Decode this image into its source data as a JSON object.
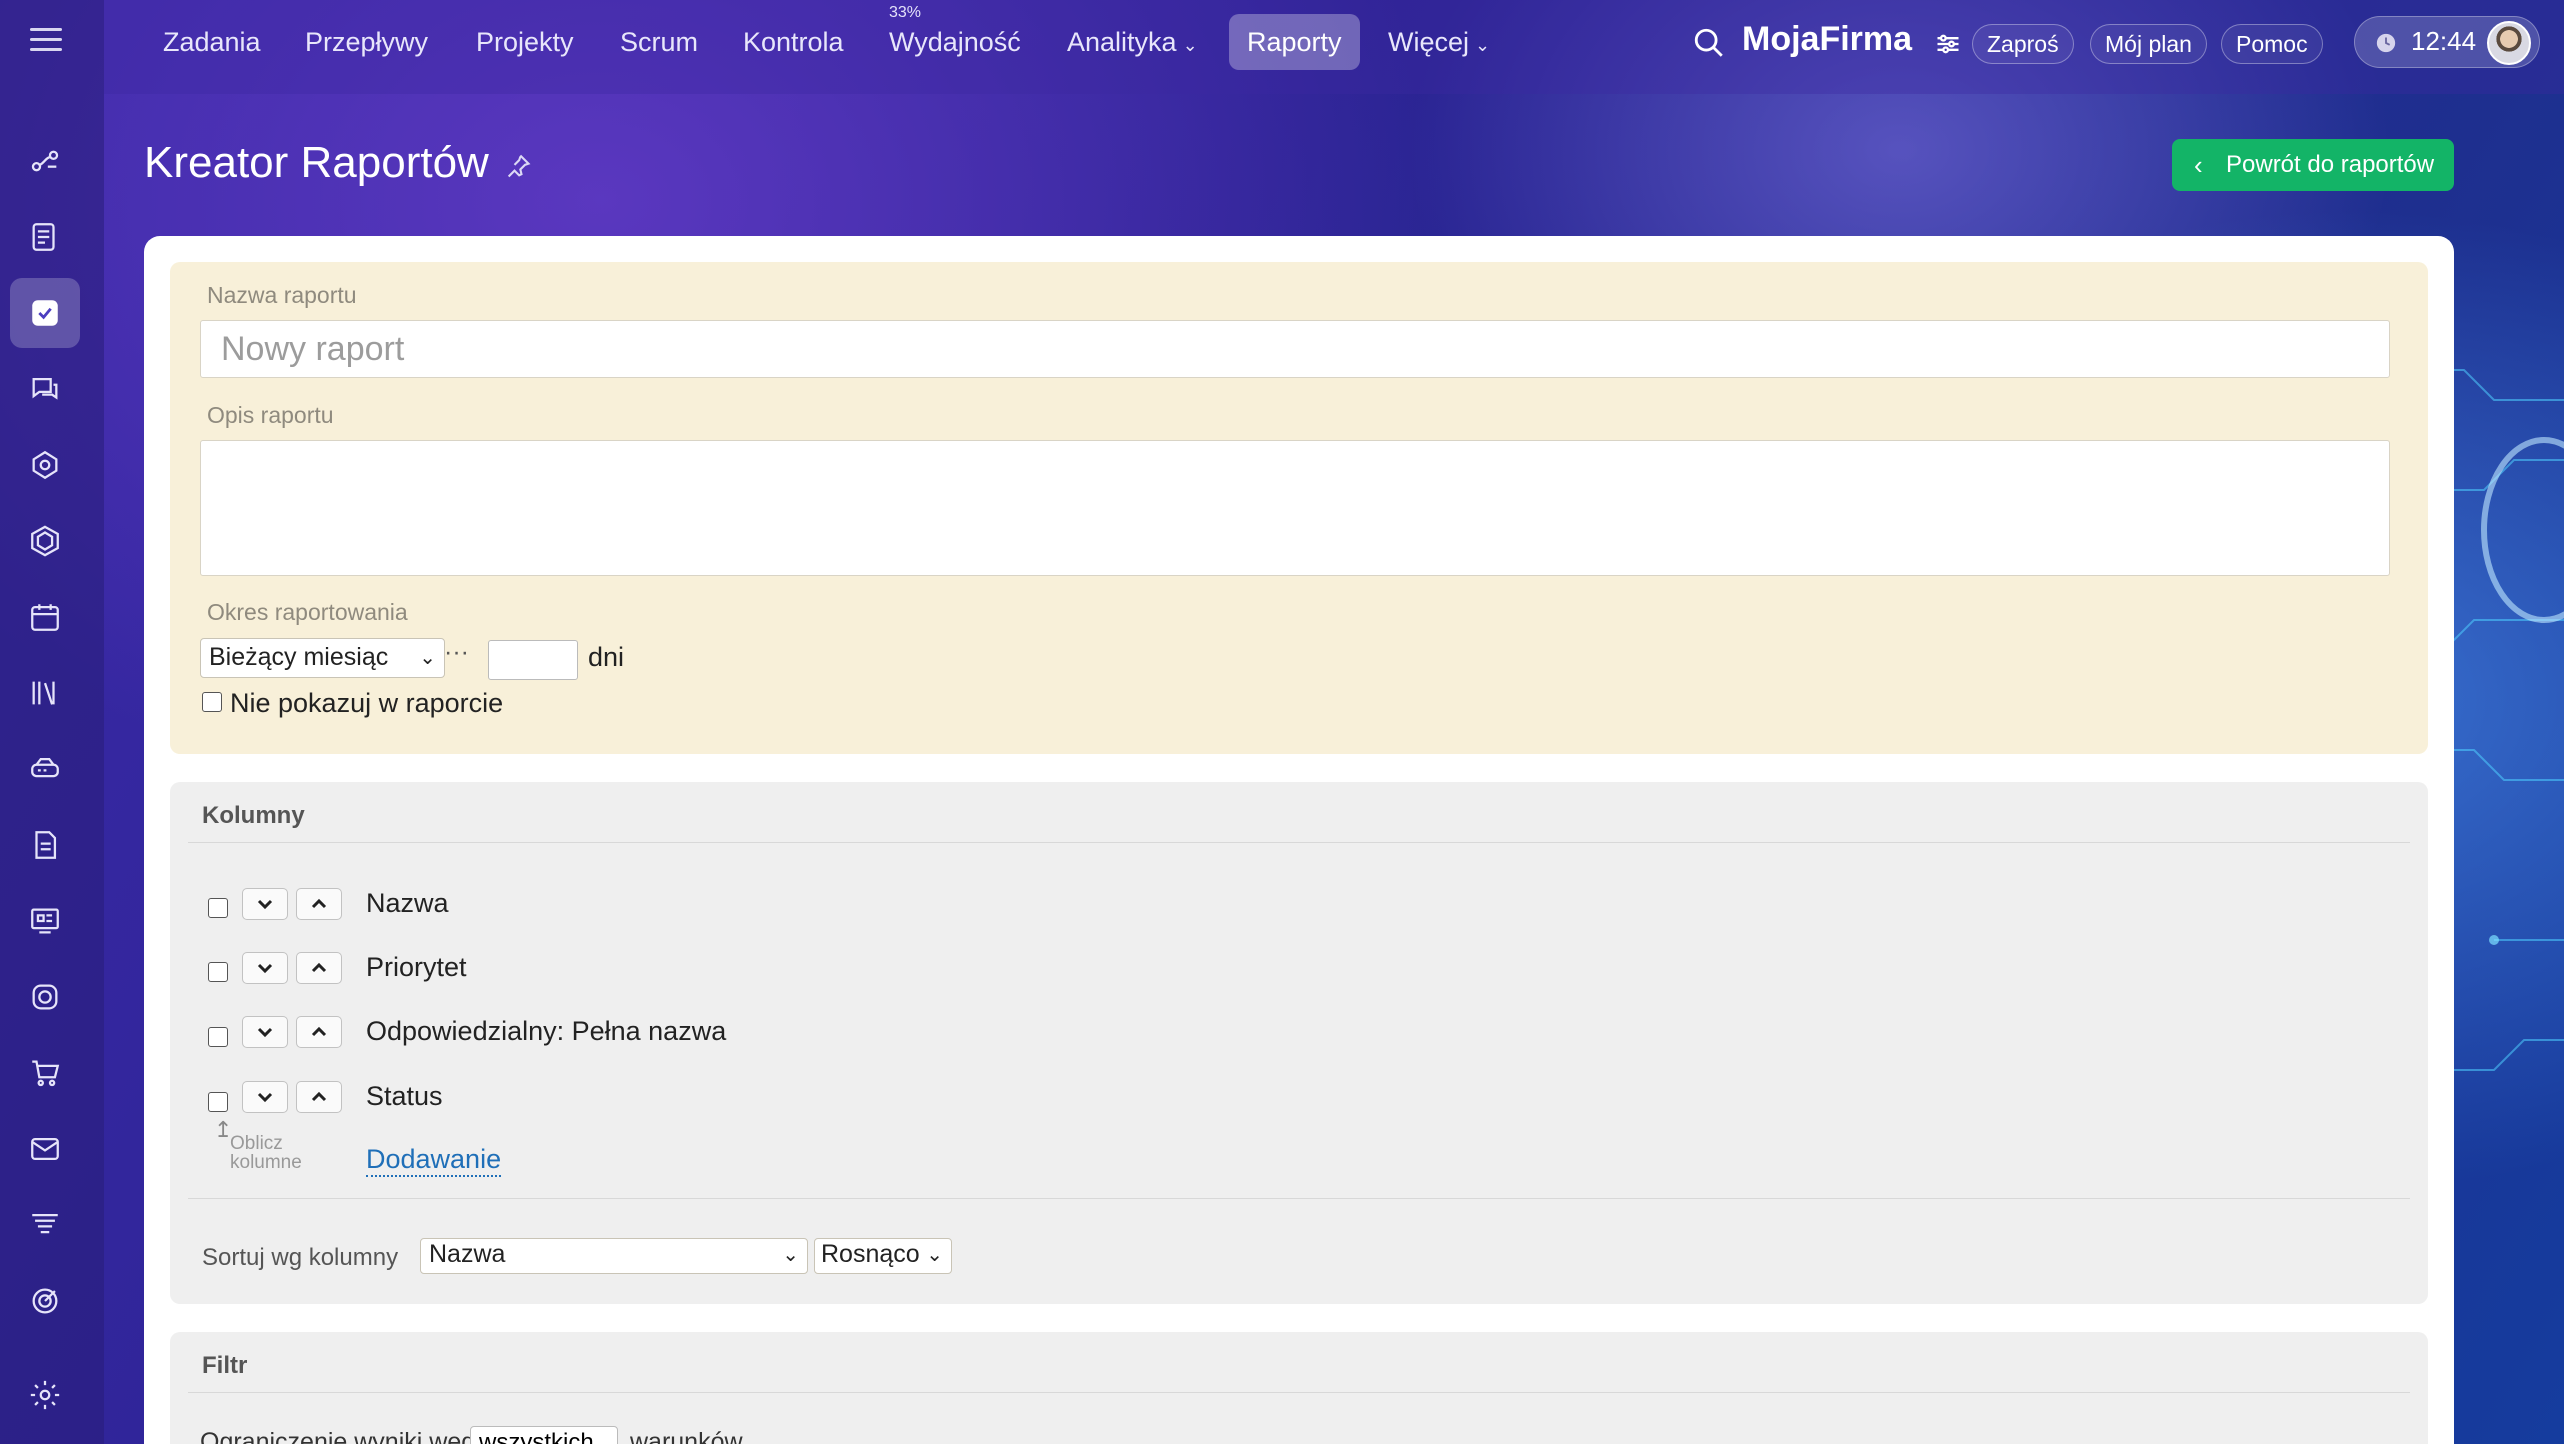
{
  "nav": {
    "items": [
      {
        "label": "Zadania"
      },
      {
        "label": "Przepływy"
      },
      {
        "label": "Projekty"
      },
      {
        "label": "Scrum"
      },
      {
        "label": "Kontrola"
      },
      {
        "label": "Wydajność",
        "badge": "33%"
      },
      {
        "label": "Analityka",
        "has_dropdown": true
      },
      {
        "label": "Raporty",
        "active": true
      },
      {
        "label": "Więcej",
        "has_dropdown": true
      }
    ],
    "brand": "MojaFirma",
    "invite": "Zaproś",
    "my_plan": "Mój plan",
    "help": "Pomoc",
    "time": "12:44"
  },
  "sidebar": {
    "icons": [
      "flow-icon",
      "newspaper-icon",
      "tasks-icon",
      "chat-icon",
      "gear-puzzle-icon",
      "hexagon-icon",
      "calendar-icon",
      "library-icon",
      "drive-icon",
      "document-icon",
      "presentation-icon",
      "support-icon",
      "cart-icon",
      "mail-icon",
      "funnel-icon",
      "target-icon",
      "settings-icon"
    ],
    "active_index": 2
  },
  "page": {
    "title": "Kreator Raportów",
    "back_button": "Powrót do raportów"
  },
  "form": {
    "name_label": "Nazwa raportu",
    "name_placeholder": "Nowy raport",
    "desc_label": "Opis raportu",
    "period_label": "Okres raportowania",
    "period_value": "Bieżący miesiąc",
    "period_separator": "···",
    "days_label": "dni",
    "hide_label": "Nie pokazuj w raporcie"
  },
  "columns": {
    "title": "Kolumny",
    "items": [
      {
        "label": "Nazwa"
      },
      {
        "label": "Priorytet"
      },
      {
        "label": "Odpowiedzialny: Pełna nazwa"
      },
      {
        "label": "Status"
      }
    ],
    "calc_label": "Oblicz kolumne",
    "add_link": "Dodawanie",
    "sort_label": "Sortuj wg kolumny",
    "sort_column": "Nazwa",
    "sort_order": "Rosnąco"
  },
  "filter": {
    "title": "Filtr",
    "text_before": "Ograniczenie wyniki według",
    "mode": "wszystkich",
    "text_after": "warunków"
  },
  "colors": {
    "accent_green": "#13b467",
    "link_blue": "#1f6fb8",
    "section_yellow": "#f8f0d9"
  }
}
